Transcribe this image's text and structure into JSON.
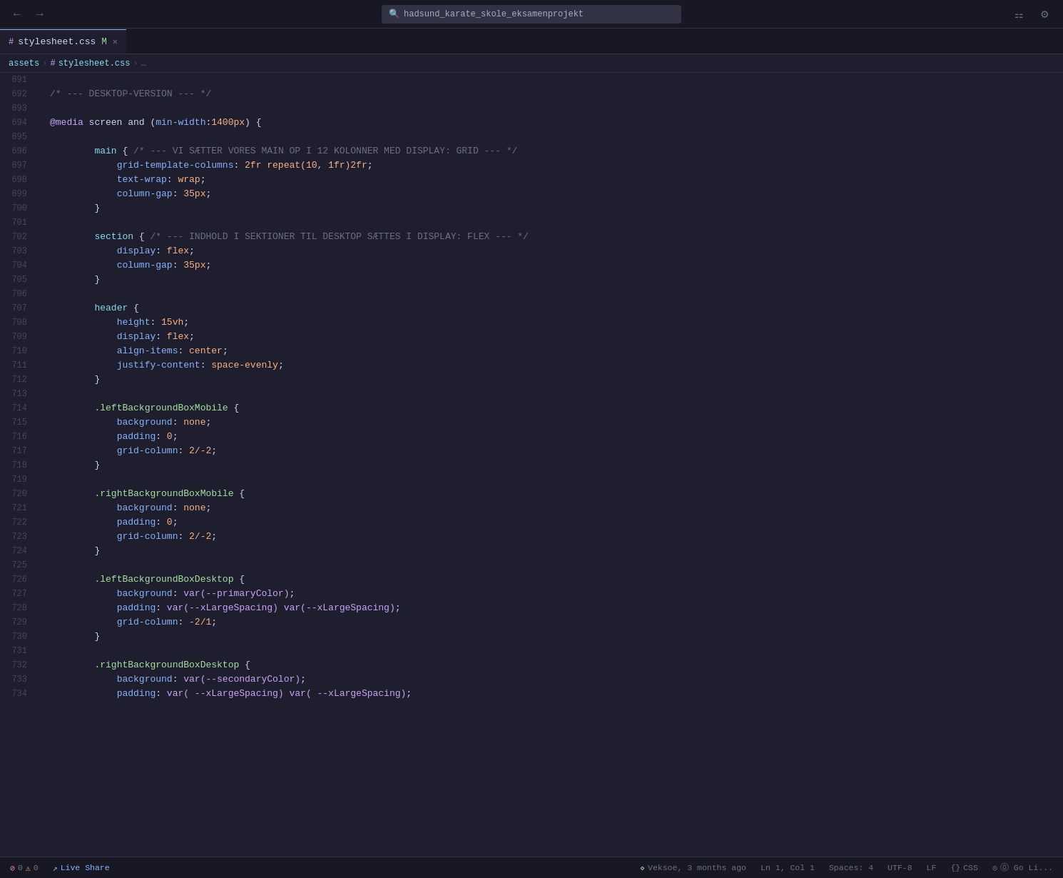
{
  "titlebar": {
    "search_placeholder": "hadsund_karate_skole_eksamenprojekt",
    "back_label": "←",
    "forward_label": "→"
  },
  "tabs": [
    {
      "id": "stylesheet",
      "hash": "#",
      "name": "stylesheet.css",
      "modified": "M",
      "active": true
    }
  ],
  "breadcrumb": {
    "parts": [
      "assets",
      "#",
      "stylesheet.css",
      "…"
    ]
  },
  "lines": [
    {
      "num": "691",
      "tokens": []
    },
    {
      "num": "692",
      "tokens": [
        {
          "t": "comment",
          "v": "/* --- DESKTOP-VERSION --- */"
        }
      ]
    },
    {
      "num": "693",
      "tokens": []
    },
    {
      "num": "694",
      "tokens": [
        {
          "t": "at",
          "v": "@media"
        },
        {
          "t": "plain",
          "v": " screen and ("
        },
        {
          "t": "property",
          "v": "min-width"
        },
        {
          "t": "punct",
          "v": ":"
        },
        {
          "t": "number",
          "v": "1400px"
        },
        {
          "t": "plain",
          "v": ") {"
        }
      ]
    },
    {
      "num": "695",
      "tokens": []
    },
    {
      "num": "696",
      "tokens": [
        {
          "t": "indent",
          "v": "        "
        },
        {
          "t": "selector",
          "v": "main"
        },
        {
          "t": "plain",
          "v": " { "
        },
        {
          "t": "comment",
          "v": "/* --- VI SÆTTER VORES MAIN OP I 12 KOLONNER MED DISPLAY: GRID --- */"
        }
      ]
    },
    {
      "num": "697",
      "tokens": [
        {
          "t": "indent",
          "v": "            "
        },
        {
          "t": "property",
          "v": "grid-template-columns"
        },
        {
          "t": "punct",
          "v": ": "
        },
        {
          "t": "value",
          "v": "2fr repeat(10, 1fr)2fr"
        },
        {
          "t": "punct",
          "v": ";"
        }
      ]
    },
    {
      "num": "698",
      "tokens": [
        {
          "t": "indent",
          "v": "            "
        },
        {
          "t": "property",
          "v": "text-wrap"
        },
        {
          "t": "punct",
          "v": ": "
        },
        {
          "t": "value",
          "v": "wrap"
        },
        {
          "t": "punct",
          "v": ";"
        }
      ]
    },
    {
      "num": "699",
      "tokens": [
        {
          "t": "indent",
          "v": "            "
        },
        {
          "t": "property",
          "v": "column-gap"
        },
        {
          "t": "punct",
          "v": ": "
        },
        {
          "t": "number",
          "v": "35px"
        },
        {
          "t": "punct",
          "v": ";"
        }
      ]
    },
    {
      "num": "700",
      "tokens": [
        {
          "t": "indent",
          "v": "        "
        },
        {
          "t": "brace",
          "v": "}"
        }
      ]
    },
    {
      "num": "701",
      "tokens": []
    },
    {
      "num": "702",
      "tokens": [
        {
          "t": "indent",
          "v": "        "
        },
        {
          "t": "selector",
          "v": "section"
        },
        {
          "t": "plain",
          "v": " { "
        },
        {
          "t": "comment",
          "v": "/* --- INDHOLD I SEKTIONER TIL DESKTOP SÆTTES I DISPLAY: FLEX --- */"
        }
      ]
    },
    {
      "num": "703",
      "tokens": [
        {
          "t": "indent",
          "v": "            "
        },
        {
          "t": "property",
          "v": "display"
        },
        {
          "t": "punct",
          "v": ": "
        },
        {
          "t": "value",
          "v": "flex"
        },
        {
          "t": "punct",
          "v": ";"
        }
      ]
    },
    {
      "num": "704",
      "tokens": [
        {
          "t": "indent",
          "v": "            "
        },
        {
          "t": "property",
          "v": "column-gap"
        },
        {
          "t": "punct",
          "v": ": "
        },
        {
          "t": "number",
          "v": "35px"
        },
        {
          "t": "punct",
          "v": ";"
        }
      ]
    },
    {
      "num": "705",
      "tokens": [
        {
          "t": "indent",
          "v": "        "
        },
        {
          "t": "brace",
          "v": "}"
        }
      ]
    },
    {
      "num": "706",
      "tokens": []
    },
    {
      "num": "707",
      "tokens": [
        {
          "t": "indent",
          "v": "        "
        },
        {
          "t": "selector",
          "v": "header"
        },
        {
          "t": "plain",
          "v": " {"
        }
      ]
    },
    {
      "num": "708",
      "tokens": [
        {
          "t": "indent",
          "v": "            "
        },
        {
          "t": "property",
          "v": "height"
        },
        {
          "t": "punct",
          "v": ": "
        },
        {
          "t": "number",
          "v": "15vh"
        },
        {
          "t": "punct",
          "v": ";"
        }
      ]
    },
    {
      "num": "709",
      "tokens": [
        {
          "t": "indent",
          "v": "            "
        },
        {
          "t": "property",
          "v": "display"
        },
        {
          "t": "punct",
          "v": ": "
        },
        {
          "t": "value",
          "v": "flex"
        },
        {
          "t": "punct",
          "v": ";"
        }
      ]
    },
    {
      "num": "710",
      "tokens": [
        {
          "t": "indent",
          "v": "            "
        },
        {
          "t": "property",
          "v": "align-items"
        },
        {
          "t": "punct",
          "v": ": "
        },
        {
          "t": "value",
          "v": "center"
        },
        {
          "t": "punct",
          "v": ";"
        }
      ]
    },
    {
      "num": "711",
      "tokens": [
        {
          "t": "indent",
          "v": "            "
        },
        {
          "t": "property",
          "v": "justify-content"
        },
        {
          "t": "punct",
          "v": ": "
        },
        {
          "t": "value",
          "v": "space-evenly"
        },
        {
          "t": "punct",
          "v": ";"
        }
      ]
    },
    {
      "num": "712",
      "tokens": [
        {
          "t": "indent",
          "v": "        "
        },
        {
          "t": "brace",
          "v": "}"
        }
      ]
    },
    {
      "num": "713",
      "tokens": []
    },
    {
      "num": "714",
      "tokens": [
        {
          "t": "indent",
          "v": "        "
        },
        {
          "t": "selector-class",
          "v": ".leftBackgroundBoxMobile"
        },
        {
          "t": "plain",
          "v": " {"
        }
      ]
    },
    {
      "num": "715",
      "tokens": [
        {
          "t": "indent",
          "v": "            "
        },
        {
          "t": "property",
          "v": "background"
        },
        {
          "t": "punct",
          "v": ": "
        },
        {
          "t": "value",
          "v": "none"
        },
        {
          "t": "punct",
          "v": ";"
        }
      ]
    },
    {
      "num": "716",
      "tokens": [
        {
          "t": "indent",
          "v": "            "
        },
        {
          "t": "property",
          "v": "padding"
        },
        {
          "t": "punct",
          "v": ": "
        },
        {
          "t": "number",
          "v": "0"
        },
        {
          "t": "punct",
          "v": ";"
        }
      ]
    },
    {
      "num": "717",
      "tokens": [
        {
          "t": "indent",
          "v": "            "
        },
        {
          "t": "property",
          "v": "grid-column"
        },
        {
          "t": "punct",
          "v": ": "
        },
        {
          "t": "value",
          "v": "2/-2"
        },
        {
          "t": "punct",
          "v": ";"
        }
      ]
    },
    {
      "num": "718",
      "tokens": [
        {
          "t": "indent",
          "v": "        "
        },
        {
          "t": "brace",
          "v": "}"
        }
      ]
    },
    {
      "num": "719",
      "tokens": []
    },
    {
      "num": "720",
      "tokens": [
        {
          "t": "indent",
          "v": "        "
        },
        {
          "t": "selector-class",
          "v": ".rightBackgroundBoxMobile"
        },
        {
          "t": "plain",
          "v": " {"
        }
      ]
    },
    {
      "num": "721",
      "tokens": [
        {
          "t": "indent",
          "v": "            "
        },
        {
          "t": "property",
          "v": "background"
        },
        {
          "t": "punct",
          "v": ": "
        },
        {
          "t": "value",
          "v": "none"
        },
        {
          "t": "punct",
          "v": ";"
        }
      ]
    },
    {
      "num": "722",
      "tokens": [
        {
          "t": "indent",
          "v": "            "
        },
        {
          "t": "property",
          "v": "padding"
        },
        {
          "t": "punct",
          "v": ": "
        },
        {
          "t": "number",
          "v": "0"
        },
        {
          "t": "punct",
          "v": ";"
        }
      ]
    },
    {
      "num": "723",
      "tokens": [
        {
          "t": "indent",
          "v": "            "
        },
        {
          "t": "property",
          "v": "grid-column"
        },
        {
          "t": "punct",
          "v": ": "
        },
        {
          "t": "value",
          "v": "2/-2"
        },
        {
          "t": "punct",
          "v": ";"
        }
      ]
    },
    {
      "num": "724",
      "tokens": [
        {
          "t": "indent",
          "v": "        "
        },
        {
          "t": "brace",
          "v": "}"
        }
      ]
    },
    {
      "num": "725",
      "tokens": []
    },
    {
      "num": "726",
      "tokens": [
        {
          "t": "indent",
          "v": "        "
        },
        {
          "t": "selector-class",
          "v": ".leftBackgroundBoxDesktop"
        },
        {
          "t": "plain",
          "v": " {"
        }
      ]
    },
    {
      "num": "727",
      "tokens": [
        {
          "t": "indent",
          "v": "            "
        },
        {
          "t": "property",
          "v": "background"
        },
        {
          "t": "punct",
          "v": ": "
        },
        {
          "t": "fn",
          "v": "var(--primaryColor)"
        },
        {
          "t": "punct",
          "v": ";"
        }
      ]
    },
    {
      "num": "728",
      "tokens": [
        {
          "t": "indent",
          "v": "            "
        },
        {
          "t": "property",
          "v": "padding"
        },
        {
          "t": "punct",
          "v": ": "
        },
        {
          "t": "fn",
          "v": "var(--xLargeSpacing) var(--xLargeSpacing)"
        },
        {
          "t": "punct",
          "v": ";"
        }
      ]
    },
    {
      "num": "729",
      "tokens": [
        {
          "t": "indent",
          "v": "            "
        },
        {
          "t": "property",
          "v": "grid-column"
        },
        {
          "t": "punct",
          "v": ": "
        },
        {
          "t": "value",
          "v": "-2/1"
        },
        {
          "t": "punct",
          "v": ";"
        }
      ]
    },
    {
      "num": "730",
      "tokens": [
        {
          "t": "indent",
          "v": "        "
        },
        {
          "t": "brace",
          "v": "}"
        }
      ]
    },
    {
      "num": "731",
      "tokens": []
    },
    {
      "num": "732",
      "tokens": [
        {
          "t": "indent",
          "v": "        "
        },
        {
          "t": "selector-class",
          "v": ".rightBackgroundBoxDesktop"
        },
        {
          "t": "plain",
          "v": " {"
        }
      ]
    },
    {
      "num": "733",
      "tokens": [
        {
          "t": "indent",
          "v": "            "
        },
        {
          "t": "property",
          "v": "background"
        },
        {
          "t": "punct",
          "v": ": "
        },
        {
          "t": "fn",
          "v": "var(--secondaryColor)"
        },
        {
          "t": "punct",
          "v": ";"
        }
      ]
    },
    {
      "num": "734",
      "tokens": [
        {
          "t": "indent",
          "v": "            "
        },
        {
          "t": "property",
          "v": "padding"
        },
        {
          "t": "punct",
          "v": ": "
        },
        {
          "t": "fn",
          "v": "var( --xLargeSpacing) var( --xLargeSpacing)"
        },
        {
          "t": "punct",
          "v": ";"
        }
      ]
    }
  ],
  "statusbar": {
    "errors": "⓪ 0",
    "live_share": "Live Share",
    "git": "Veksoe, 3 months ago",
    "position": "Ln 1, Col 1",
    "spaces": "Spaces: 4",
    "encoding": "UTF-8",
    "eol": "LF",
    "language": "CSS",
    "go_live": "⓪ Go Li..."
  }
}
